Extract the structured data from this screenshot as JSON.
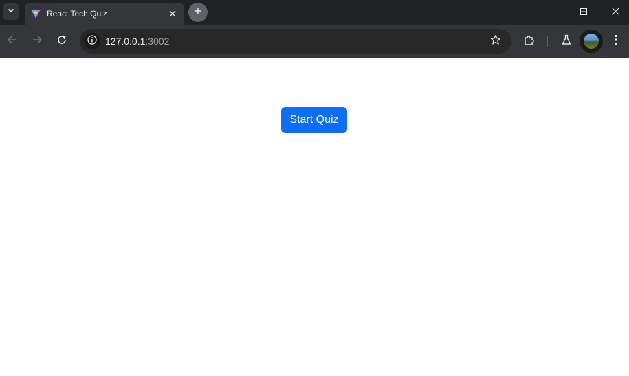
{
  "browser": {
    "tab": {
      "title": "React Tech Quiz",
      "favicon": "vite-icon"
    },
    "address_bar": {
      "host": "127.0.0.1",
      "port": ":3002"
    },
    "colors": {
      "titlebar": "#202124",
      "toolbar": "#35363a",
      "omnibox": "#282828"
    }
  },
  "page": {
    "start_button_label": "Start Quiz",
    "colors": {
      "button_bg": "#0d6efd",
      "button_text": "#ffffff",
      "background": "#ffffff"
    }
  }
}
